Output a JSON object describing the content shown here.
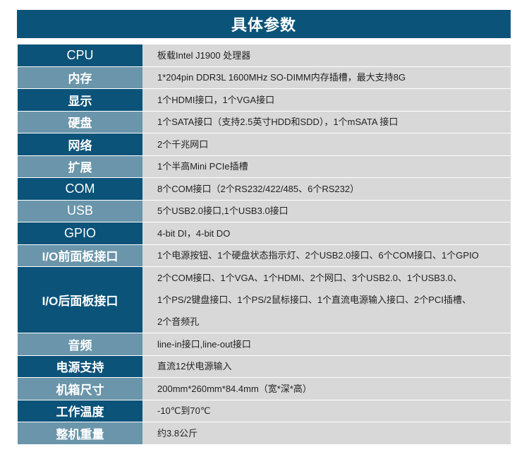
{
  "title": "具体参数",
  "colors": {
    "header_bg": "#0b5379",
    "label_dark": "#0b5379",
    "label_light": "#6a95aa",
    "value_bg": "#d8d8d8"
  },
  "specs": [
    {
      "label": "CPU",
      "lines": [
        "板载Intel J1900 处理器"
      ]
    },
    {
      "label": "内存",
      "lines": [
        "1*204pin DDR3L 1600MHz SO-DIMM内存插槽，最大支持8G"
      ]
    },
    {
      "label": "显示",
      "lines": [
        "1个HDMI接口，1个VGA接口"
      ]
    },
    {
      "label": "硬盘",
      "lines": [
        "1个SATA接口（支持2.5英寸HDD和SDD），1个mSATA 接口"
      ]
    },
    {
      "label": "网络",
      "lines": [
        "2个千兆网口"
      ]
    },
    {
      "label": "扩展",
      "lines": [
        "1个半高Mini PCIe插槽"
      ]
    },
    {
      "label": "COM",
      "lines": [
        "8个COM接口（2个RS232/422/485、6个RS232）"
      ]
    },
    {
      "label": "USB",
      "lines": [
        "5个USB2.0接口,1个USB3.0接口"
      ]
    },
    {
      "label": "GPIO",
      "lines": [
        "4-bit DI，4-bit DO"
      ]
    },
    {
      "label": "I/O前面板接口",
      "lines": [
        "1个电源按钮、1个硬盘状态指示灯、2个USB2.0接口、6个COM接口、1个GPIO"
      ]
    },
    {
      "label": "I/O后面板接口",
      "lines": [
        "2个COM接口、1个VGA、1个HDMI、2个网口、3个USB2.0、1个USB3.0、",
        "1个PS/2键盘接口、1个PS/2鼠标接口、1个直流电源输入接口、2个PCI插槽、",
        "2个音频孔"
      ]
    },
    {
      "label": "音频",
      "lines": [
        "line-in接口,line-out接口"
      ]
    },
    {
      "label": "电源支持",
      "lines": [
        "直流12伏电源输入"
      ]
    },
    {
      "label": "机箱尺寸",
      "lines": [
        "200mm*260mm*84.4mm（宽*深*高）"
      ]
    },
    {
      "label": "工作温度",
      "lines": [
        "-10℃到70℃"
      ]
    },
    {
      "label": "整机重量",
      "lines": [
        "约3.8公斤"
      ]
    }
  ]
}
